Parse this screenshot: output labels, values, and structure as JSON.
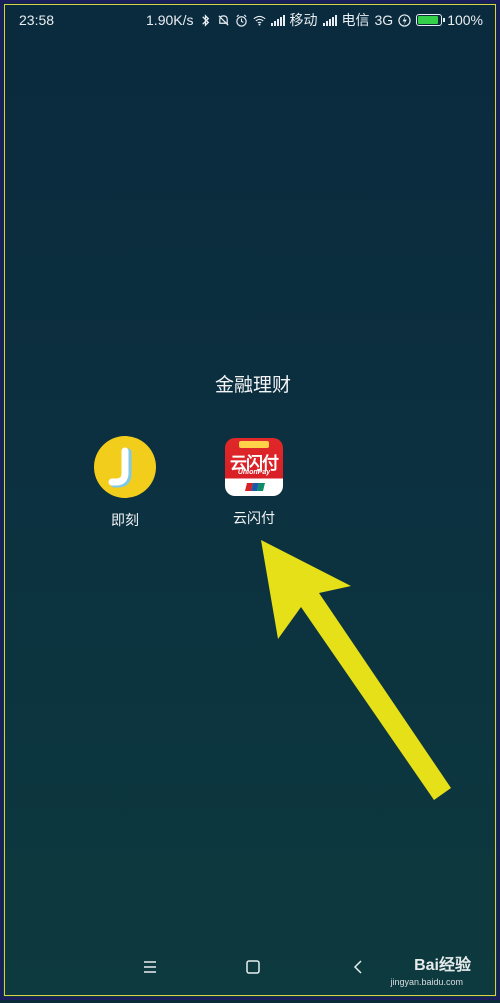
{
  "status_bar": {
    "time": "23:58",
    "speed": "1.90K/s",
    "carrier1": "移动",
    "carrier2": "电信",
    "network": "3G",
    "battery_level": "100%",
    "icons": [
      "bluetooth-icon",
      "mute-icon",
      "alarm-icon",
      "wifi-icon",
      "signal-icon",
      "signal-icon",
      "charging-icon",
      "battery-icon"
    ]
  },
  "folder": {
    "title": "金融理财",
    "apps": [
      {
        "label": "即刻",
        "icon": "jike-app-icon",
        "color": "#f2cd1c"
      },
      {
        "label": "云闪付",
        "icon": "unionpay-app-icon",
        "color": "#e0282a",
        "icon_text": "云闪付",
        "icon_subtext": "UnionPay"
      }
    ]
  },
  "navigation": {
    "icons": [
      "menu-icon",
      "home-icon",
      "back-icon"
    ]
  },
  "annotation": {
    "color": "#e6e019"
  },
  "watermark": {
    "text": "Bai经验",
    "url": "jingyan.baidu.com"
  }
}
